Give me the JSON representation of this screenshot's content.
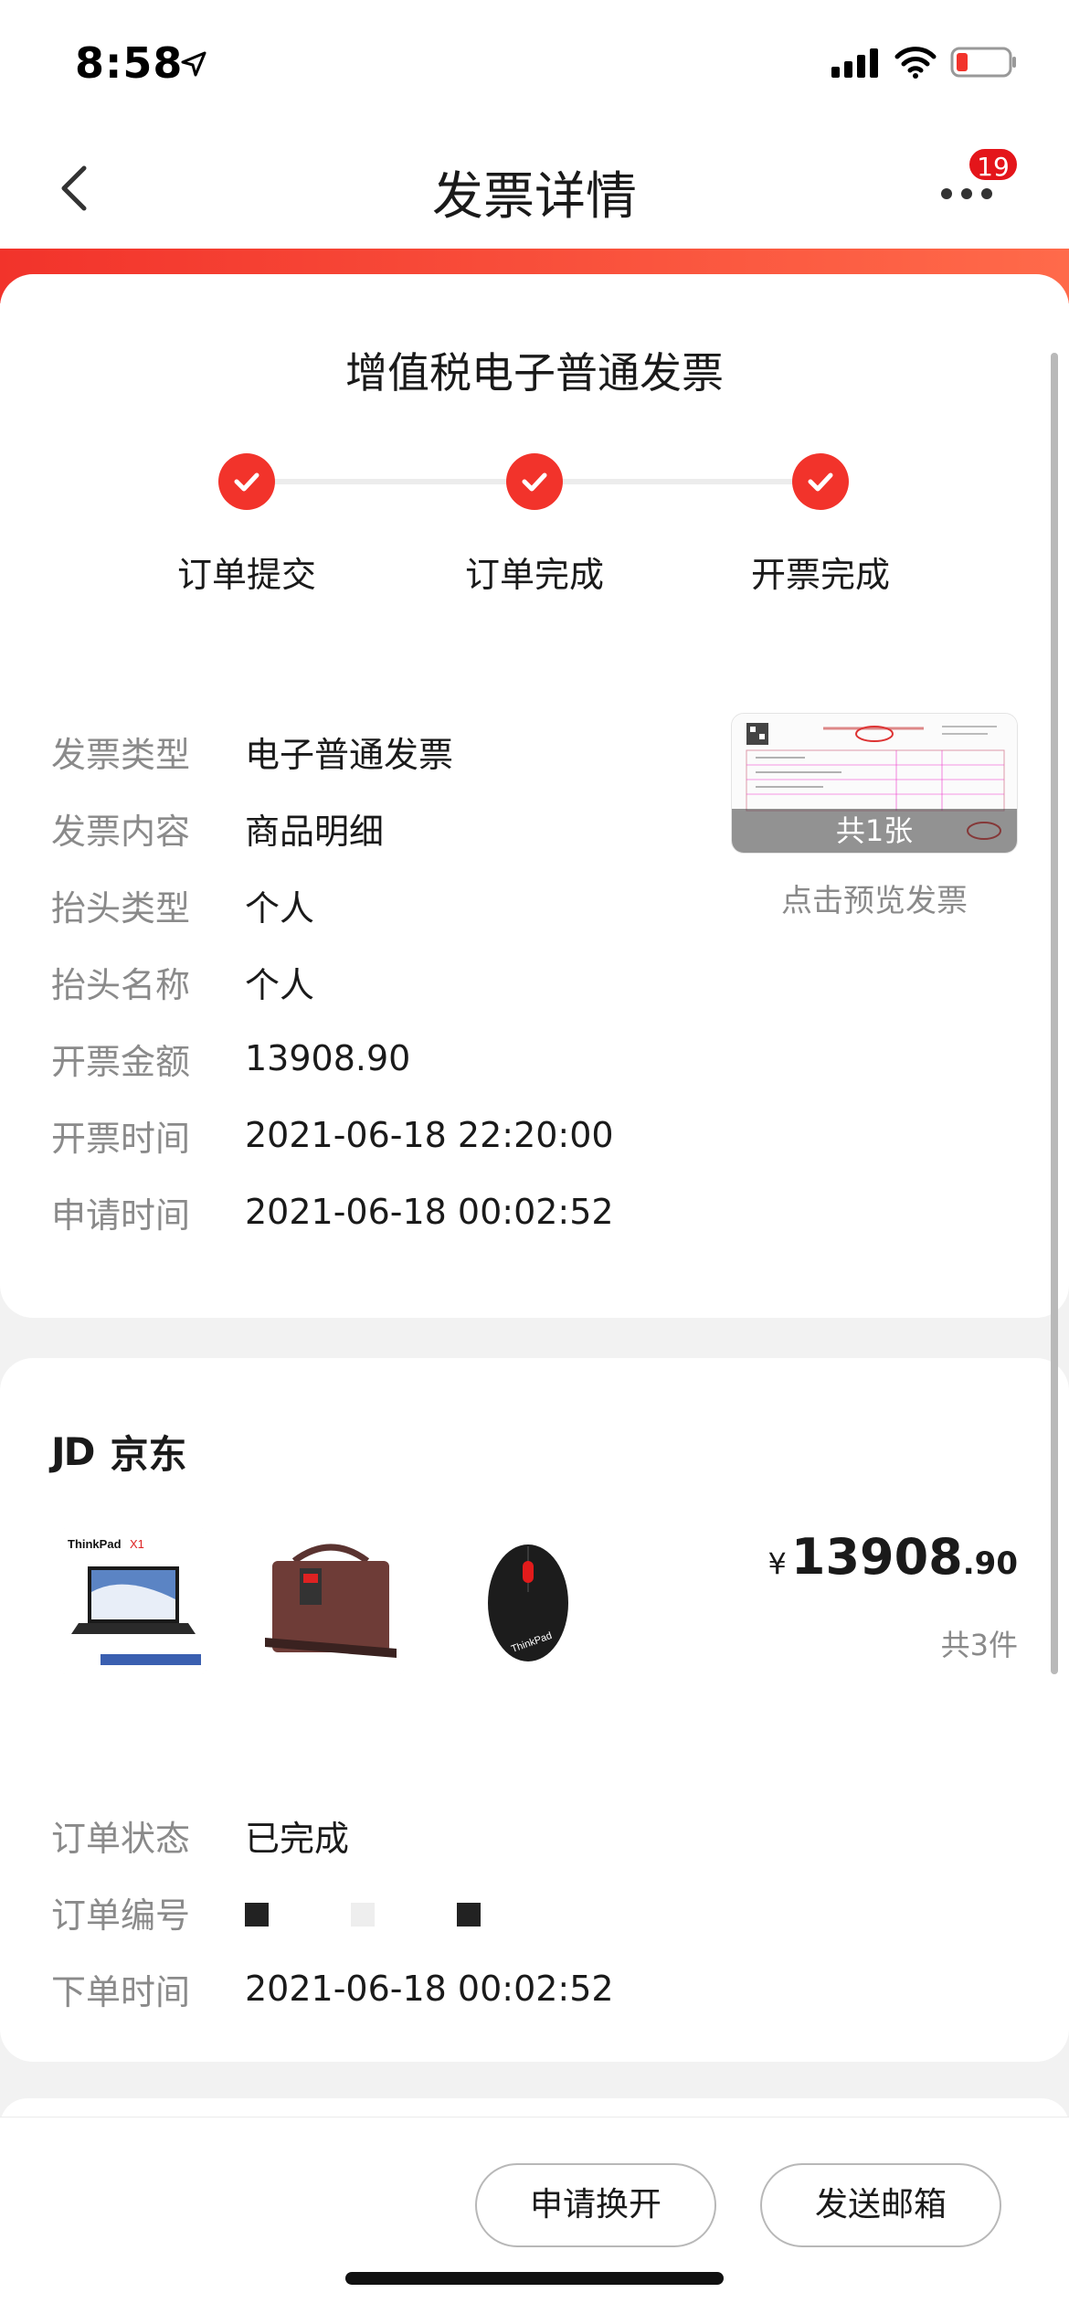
{
  "status_bar": {
    "time": "8:58"
  },
  "nav": {
    "title": "发票详情",
    "badge_count": "19"
  },
  "invoice": {
    "type_title": "增值税电子普通发票",
    "steps": [
      {
        "label": "订单提交",
        "done": true
      },
      {
        "label": "订单完成",
        "done": true
      },
      {
        "label": "开票完成",
        "done": true
      }
    ],
    "fields": [
      {
        "label": "发票类型",
        "value": "电子普通发票"
      },
      {
        "label": "发票内容",
        "value": "商品明细"
      },
      {
        "label": "抬头类型",
        "value": "个人"
      },
      {
        "label": "抬头名称",
        "value": "个人"
      },
      {
        "label": "开票金额",
        "value": "13908.90"
      },
      {
        "label": "开票时间",
        "value": "2021-06-18 22:20:00"
      },
      {
        "label": "申请时间",
        "value": "2021-06-18 00:02:52"
      }
    ],
    "preview": {
      "count_label": "共1张",
      "action_label": "点击预览发票"
    }
  },
  "order": {
    "shop_logo": "JD",
    "shop_name": "京东",
    "products": [
      {
        "icon": "laptop-image"
      },
      {
        "icon": "laptop-bag-image"
      },
      {
        "icon": "mouse-image"
      }
    ],
    "price": {
      "currency": "¥",
      "integer": "13908",
      "decimal": ".90"
    },
    "item_count": "共3件",
    "fields": [
      {
        "label": "订单状态",
        "value": "已完成"
      },
      {
        "label": "订单编号",
        "value": ""
      },
      {
        "label": "下单时间",
        "value": "2021-06-18 00:02:52"
      }
    ]
  },
  "actions": {
    "reissue": "申请换开",
    "send_email": "发送邮箱"
  },
  "colors": {
    "accent": "#f2332b",
    "badge": "#e4151a"
  }
}
